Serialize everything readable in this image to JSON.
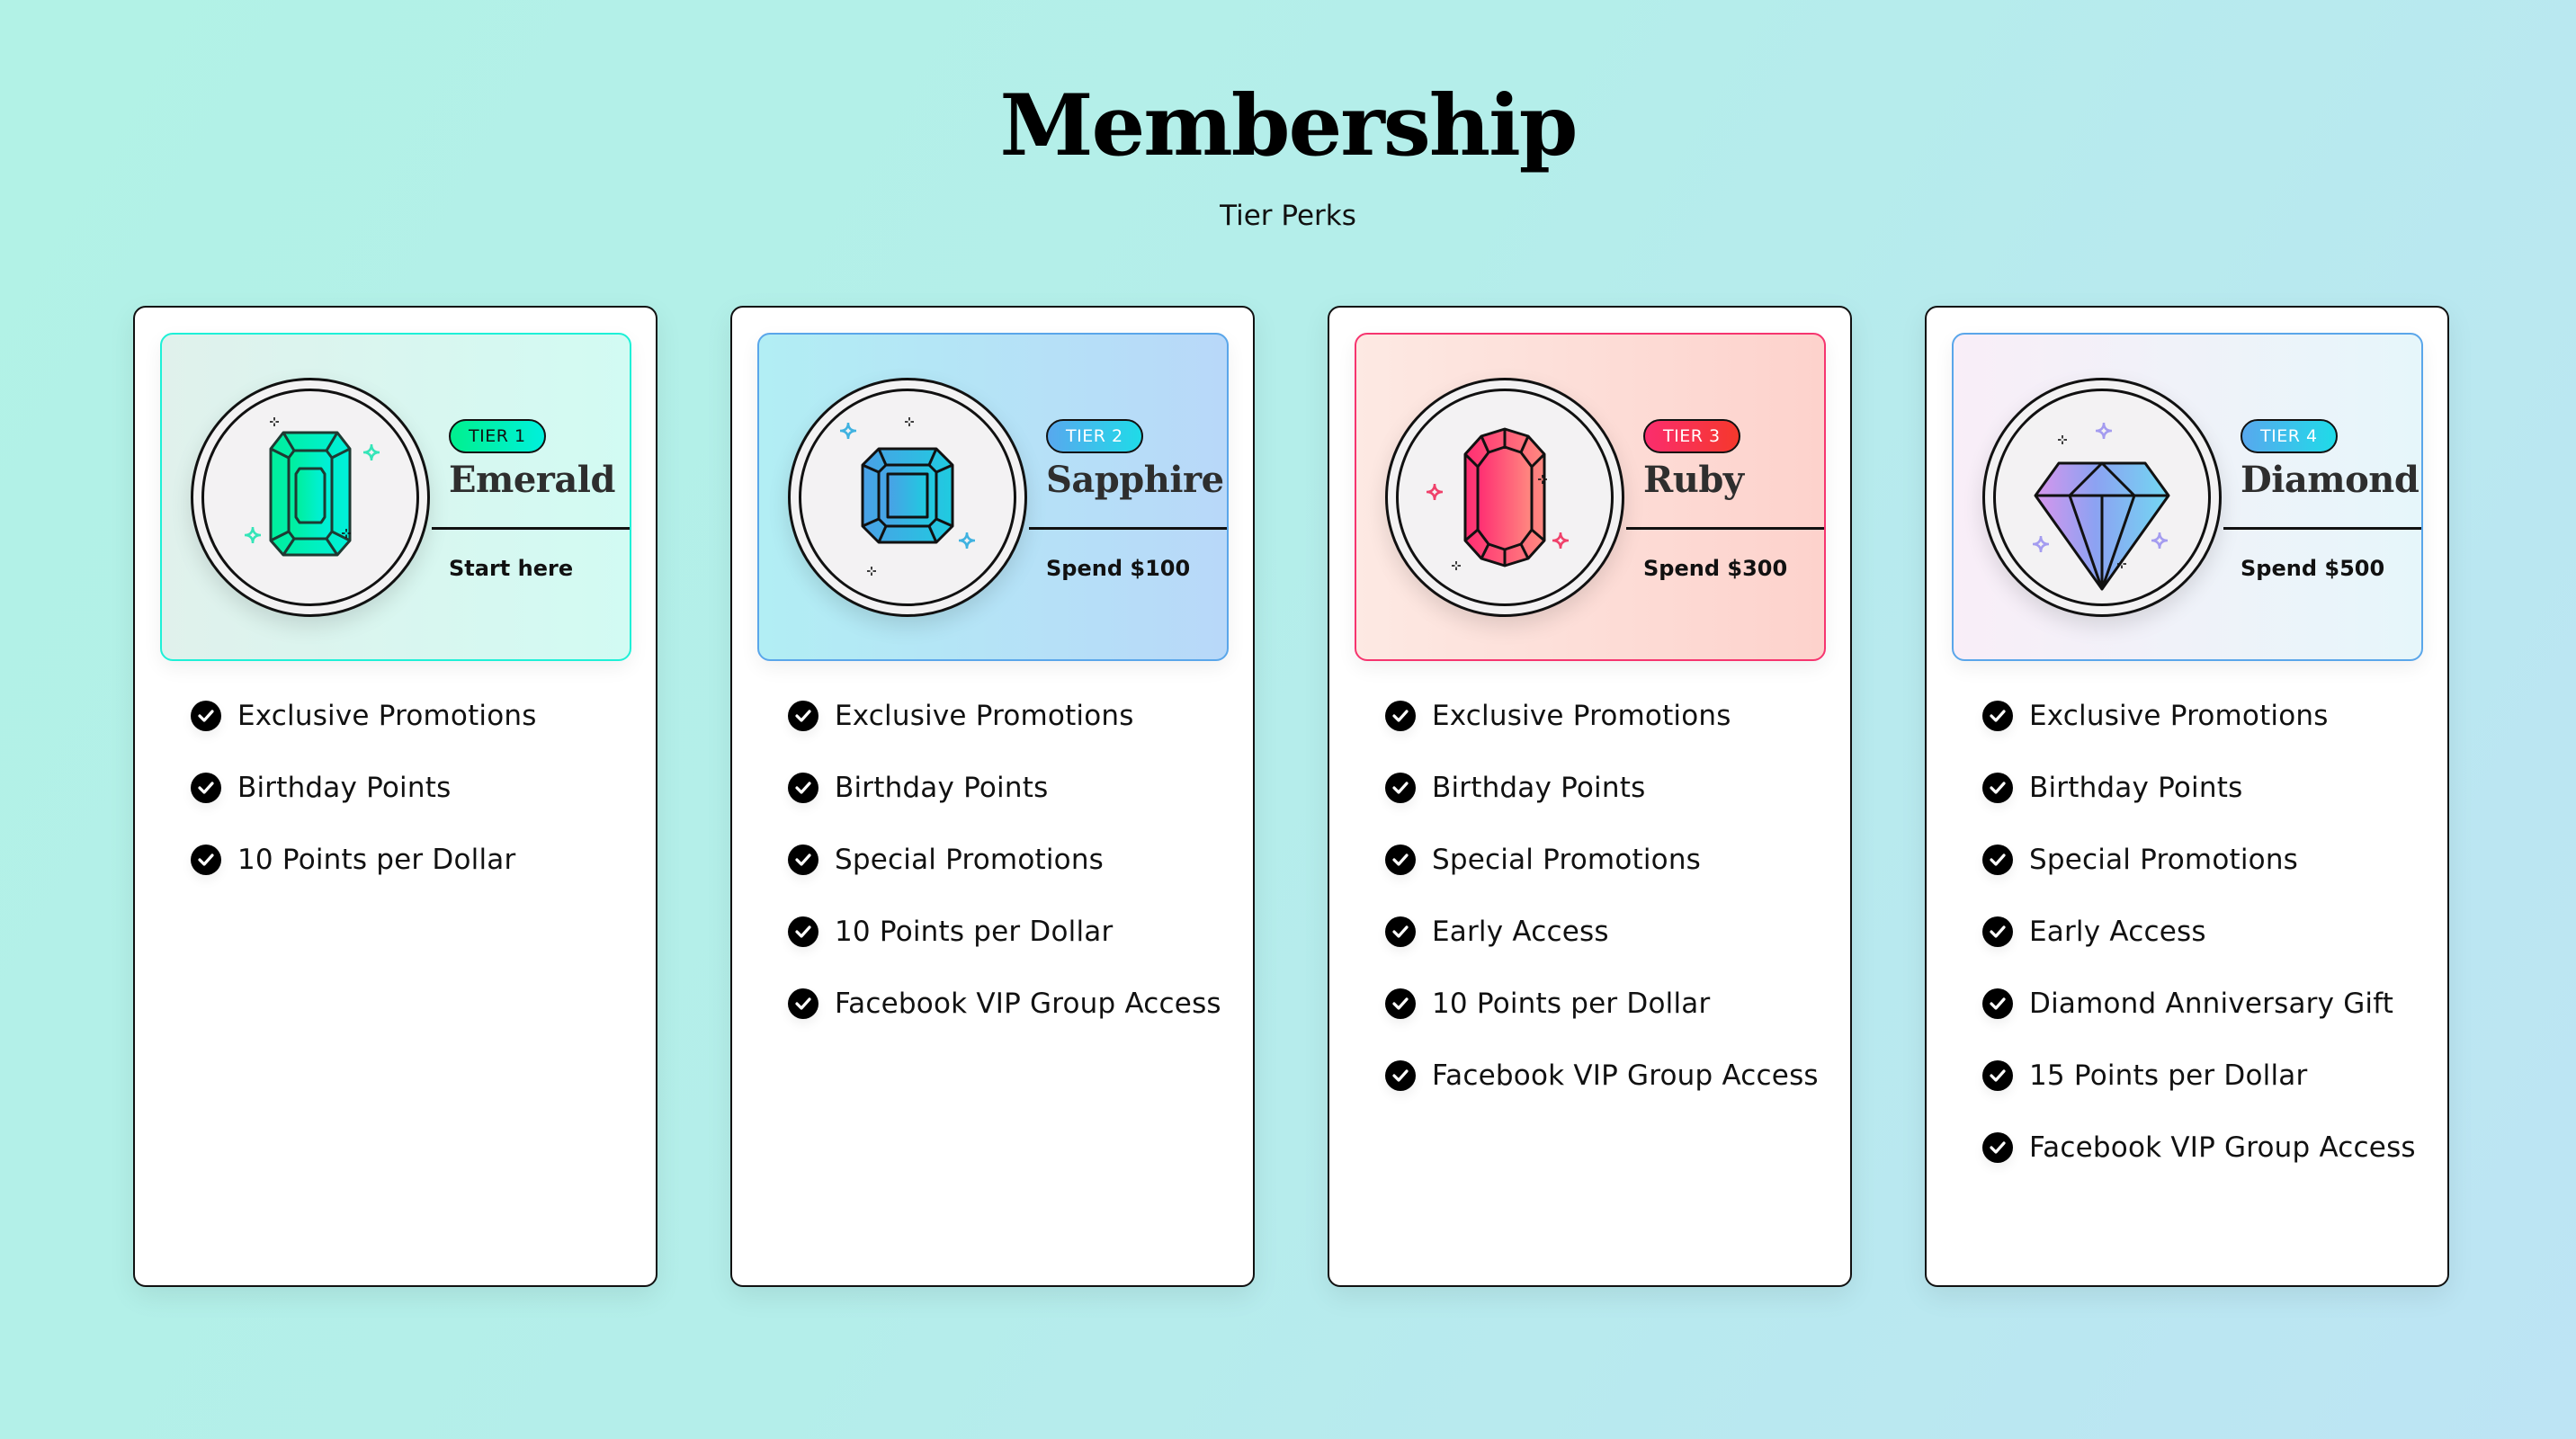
{
  "header": {
    "title": "Membership",
    "subtitle": "Tier Perks"
  },
  "tiers": [
    {
      "badge": "TIER 1",
      "name": "Emerald",
      "requirement": "Start here",
      "gem_icon": "emerald-gem-icon",
      "colors": {
        "panel_from": "#e0f1ec",
        "panel_to": "#d2fbf3",
        "panel_border": "#1ef0d7",
        "badge_from": "#00f08e",
        "badge_to": "#00f0dc",
        "badge_text": "#111111",
        "gem_from": "#00ef9b",
        "gem_to": "#00f0dc",
        "sparkle": "#35e5b8"
      },
      "perks": [
        "Exclusive Promotions",
        "Birthday Points",
        "10 Points per Dollar"
      ]
    },
    {
      "badge": "TIER 2",
      "name": "Sapphire",
      "requirement": "Spend $100",
      "gem_icon": "sapphire-gem-icon",
      "colors": {
        "panel_from": "#b2eef4",
        "panel_to": "#b8d8f9",
        "panel_border": "#5aa6ea",
        "badge_from": "#58a8ee",
        "badge_to": "#1fdbe8",
        "badge_text": "#ffffff",
        "gem_from": "#4aa0e6",
        "gem_to": "#1fcbe0",
        "sparkle": "#3fb2e0"
      },
      "perks": [
        "Exclusive Promotions",
        "Birthday Points",
        "Special Promotions",
        "10 Points per Dollar",
        "Facebook VIP Group Access"
      ]
    },
    {
      "badge": "TIER 3",
      "name": "Ruby",
      "requirement": "Spend $300",
      "gem_icon": "ruby-gem-icon",
      "colors": {
        "panel_from": "#fde9e3",
        "panel_to": "#fdd2cc",
        "panel_border": "#f6356f",
        "badge_from": "#fb2d6e",
        "badge_to": "#f5382c",
        "badge_text": "#ffffff",
        "gem_from": "#ff2d72",
        "gem_to": "#ff8a80",
        "sparkle": "#f0416a"
      },
      "perks": [
        "Exclusive Promotions",
        "Birthday Points",
        "Special Promotions",
        "Early Access",
        "10 Points per Dollar",
        "Facebook VIP Group Access"
      ]
    },
    {
      "badge": "TIER 4",
      "name": "Diamond",
      "requirement": "Spend $500",
      "gem_icon": "diamond-gem-icon",
      "colors": {
        "panel_from": "#f9eef8",
        "panel_to": "#e6f6fa",
        "panel_border": "#5aa6ea",
        "badge_from": "#58a8ee",
        "badge_to": "#1fdbe8",
        "badge_text": "#ffffff",
        "gem_from": "#d895ec",
        "gem_mid": "#8ca2f2",
        "gem_to": "#72d8f2",
        "sparkle": "#a49cf0"
      },
      "perks": [
        "Exclusive Promotions",
        "Birthday Points",
        "Special Promotions",
        "Early Access",
        "Diamond Anniversary Gift",
        "15 Points per Dollar",
        "Facebook VIP Group Access"
      ]
    }
  ]
}
